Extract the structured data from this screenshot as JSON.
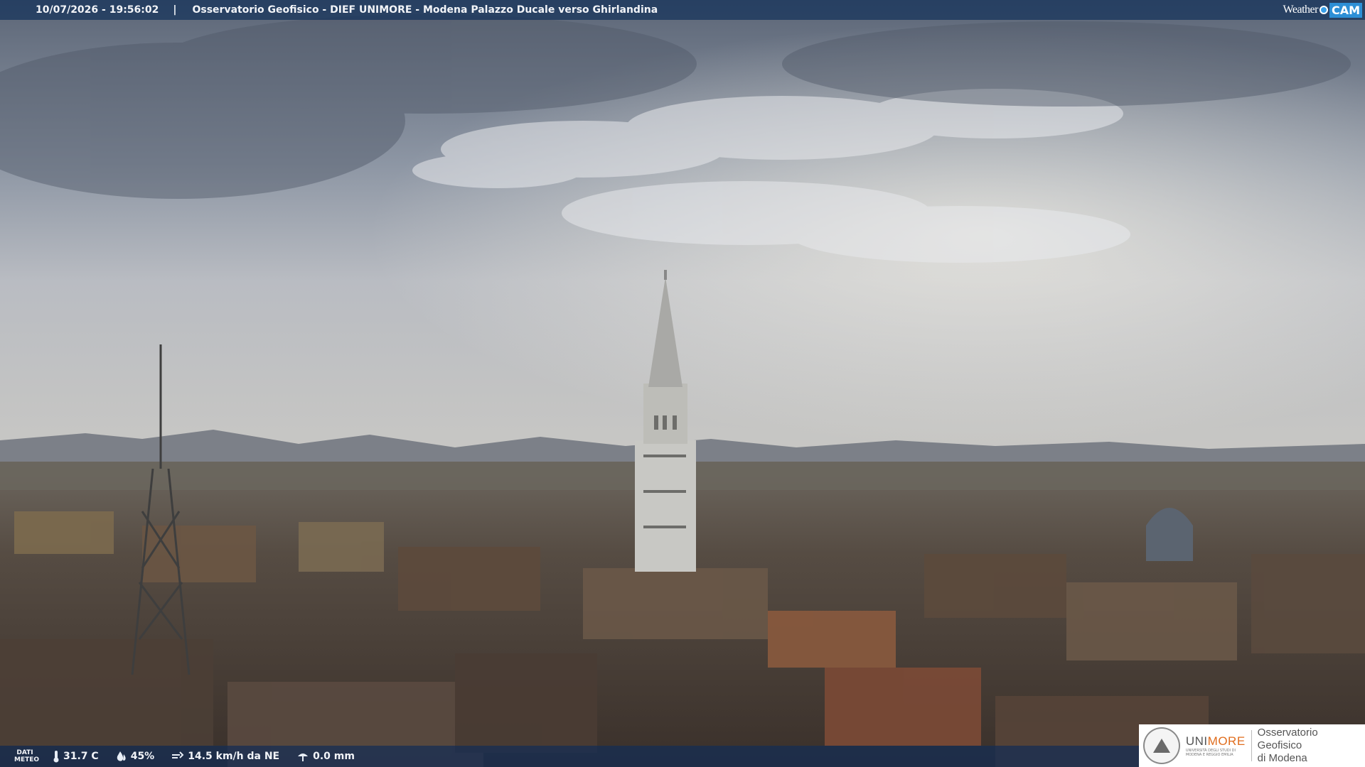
{
  "header": {
    "timestamp": "10/07/2026 - 19:56:02",
    "separator": "|",
    "caption": "Osservatorio Geofisico - DIEF UNIMORE - Modena Palazzo Ducale verso Ghirlandina"
  },
  "brand": {
    "weather": "Weather",
    "cam": "CAM",
    "accent_color": "#2d8fd6"
  },
  "meteo": {
    "label_line1": "DATI",
    "label_line2": "METEO",
    "temperature": "31.7 C",
    "humidity": "45%",
    "wind": "14.5 km/h da NE",
    "rain": "0.0 mm",
    "icons": [
      "thermometer-icon",
      "humidity-icon",
      "wind-icon",
      "rain-icon"
    ]
  },
  "logo": {
    "uni_part1": "UNI",
    "uni_part2": "MORE",
    "uni_sub1": "UNIVERSITÀ DEGLI STUDI DI",
    "uni_sub2": "MODENA E REGGIO EMILIA",
    "obs_line1": "Osservatorio Geofisico",
    "obs_line2": "di Modena",
    "accent_color": "#e06d1e"
  }
}
